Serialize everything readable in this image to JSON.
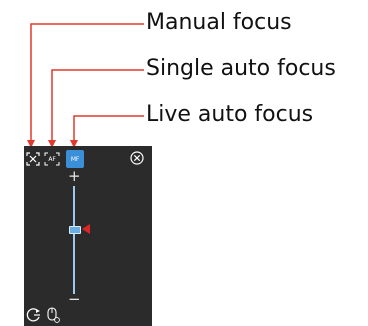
{
  "callouts": {
    "manual_focus": "Manual focus",
    "single_auto_focus": "Single auto focus",
    "live_auto_focus": "Live auto focus"
  },
  "panel": {
    "af_label": "AF",
    "mf_label": "MF",
    "slider": {
      "plus": "+",
      "minus": "−"
    }
  },
  "colors": {
    "callout_line": "#e03a2f",
    "panel_bg": "#2b2b2b",
    "active_button": "#3a8fd8",
    "slider_track": "#9ec9ef",
    "marker": "#e02424"
  },
  "icons": {
    "manual_focus": "crosshair-arrows-icon",
    "single_auto_focus": "af-bracket-icon",
    "live_auto_focus": "mf-active-icon",
    "close": "close-circle-icon",
    "rotate": "rotate-icon",
    "mouse": "mouse-icon"
  }
}
